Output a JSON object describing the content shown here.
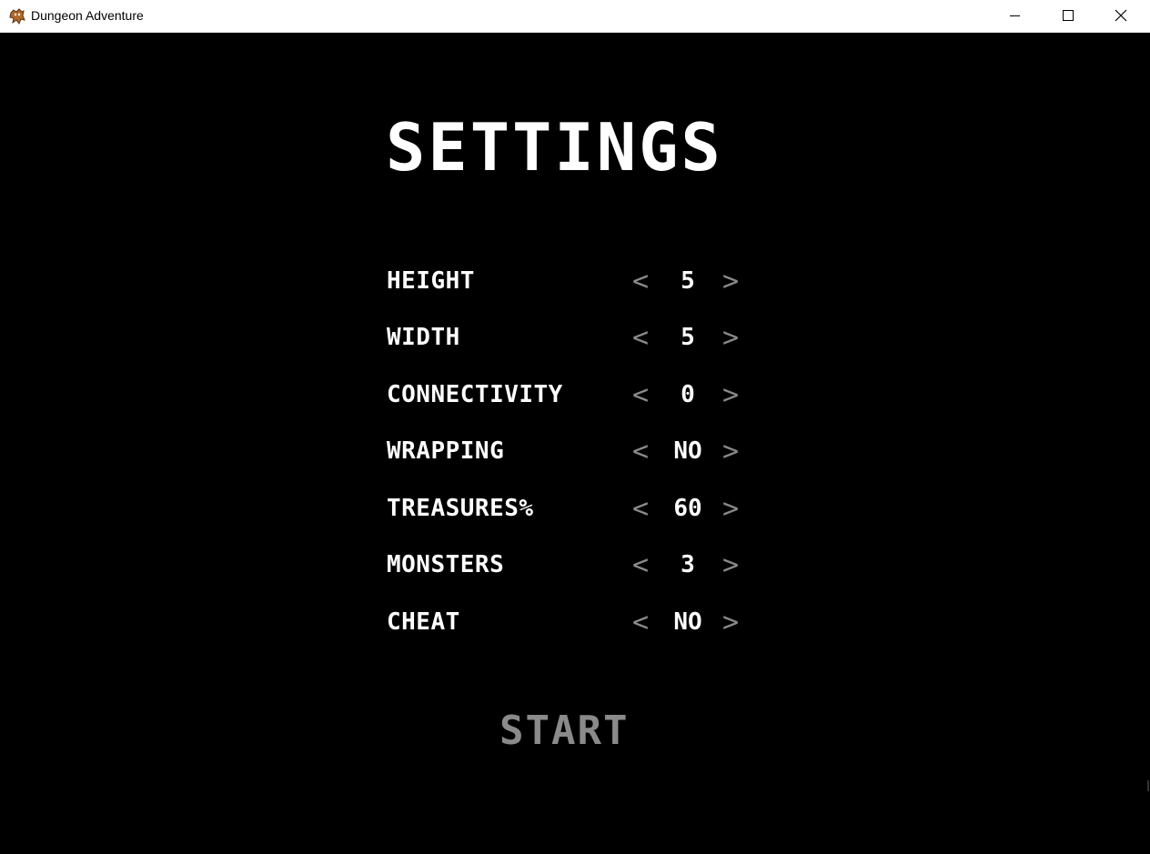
{
  "window": {
    "title": "Dungeon Adventure",
    "icon": "dungeon-app-icon"
  },
  "settings": {
    "heading": "SETTINGS",
    "rows": [
      {
        "label": "HEIGHT",
        "value": "5"
      },
      {
        "label": "WIDTH",
        "value": "5"
      },
      {
        "label": "CONNECTIVITY",
        "value": "0"
      },
      {
        "label": "WRAPPING",
        "value": "NO"
      },
      {
        "label": "TREASURES%",
        "value": "60"
      },
      {
        "label": "MONSTERS",
        "value": "3"
      },
      {
        "label": "CHEAT",
        "value": "NO"
      }
    ],
    "decrement": "<",
    "increment": ">",
    "start_label": "START"
  },
  "colors": {
    "background": "#000000",
    "text": "#ffffff",
    "dim": "#8a8a8a"
  }
}
